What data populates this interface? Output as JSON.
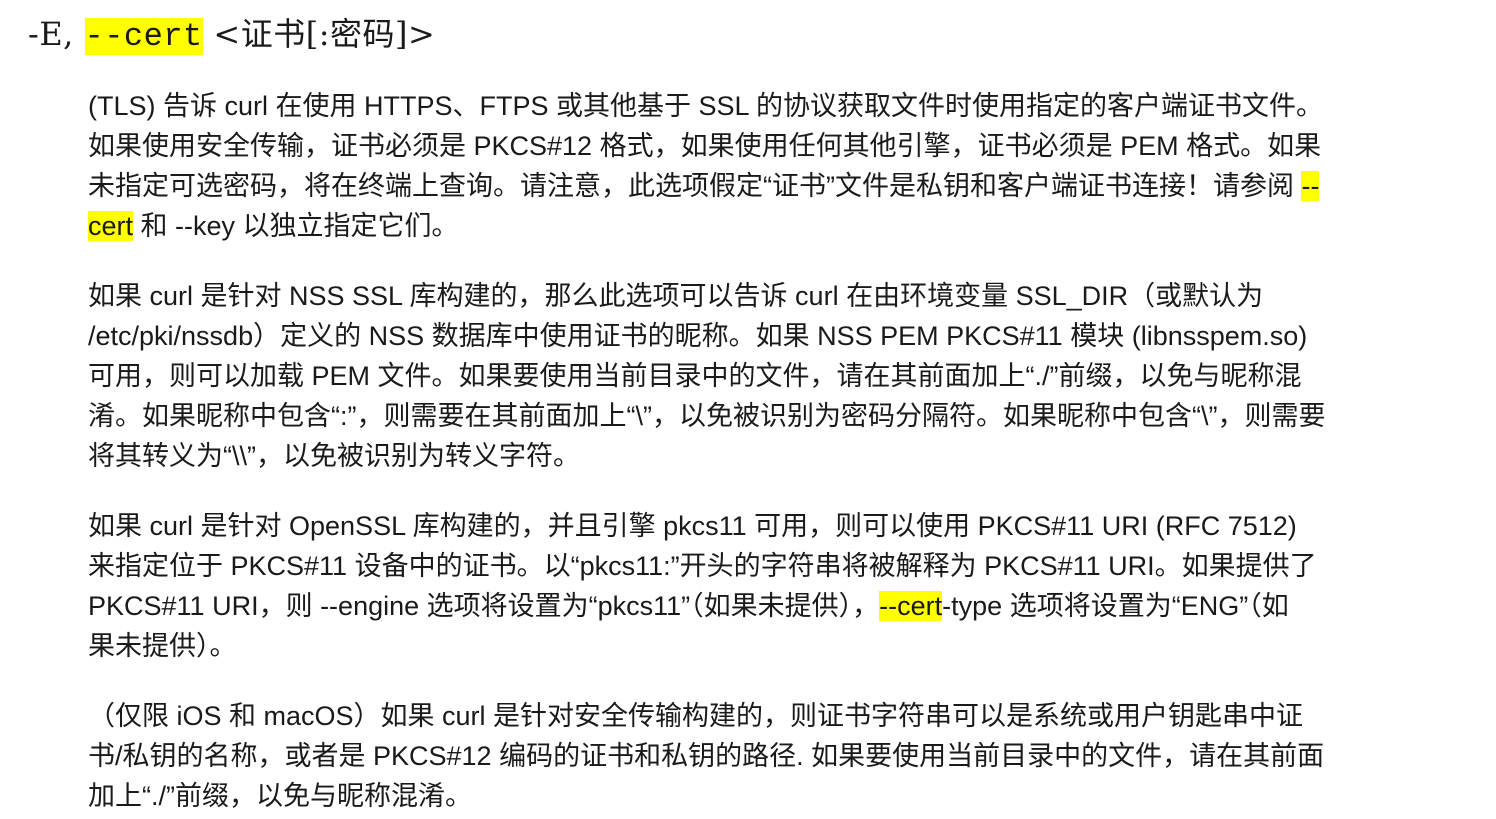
{
  "heading": {
    "prefix": "-E, ",
    "option": "--cert",
    "gap": " ",
    "argument": "<证书[:密码]>"
  },
  "paragraphs": [
    {
      "lines": [
        {
          "parts": [
            "(TLS) 告诉 curl 在使用 HTTPS、FTPS 或其他基于 SSL 的协议获取文件时使用指定的客户端证书文件。"
          ]
        },
        {
          "parts": [
            "如果使用安全传输，证书必须是 PKCS#12 格式，如果使用任何其他引擎，证书必须是 PEM 格式。如果"
          ]
        },
        {
          "parts": [
            "未指定可选密码，将在终端上查询。请注意，此选项假定“证书”文件是私钥和客户端证书连接！请参阅 "
          ],
          "highlight": "--"
        },
        {
          "highlight_lead": "cert",
          "parts": [
            " 和 --key 以独立指定它们。"
          ]
        }
      ]
    },
    {
      "lines": [
        {
          "parts": [
            "如果 curl 是针对 NSS SSL 库构建的，那么此选项可以告诉 curl 在由环境变量 SSL_DIR（或默认为"
          ]
        },
        {
          "parts": [
            "/etc/pki/nssdb）定义的 NSS 数据库中使用证书的昵称。如果 NSS PEM PKCS#11 模块 (libnsspem.so)"
          ]
        },
        {
          "parts": [
            "可用，则可以加载 PEM 文件。如果要使用当前目录中的文件，请在其前面加上“./”前缀，以免与昵称混"
          ]
        },
        {
          "parts": [
            "淆。如果昵称中包含“:”，则需要在其前面加上“\\”，以免被识别为密码分隔符。如果昵称中包含“\\”，则需要"
          ]
        },
        {
          "parts": [
            "将其转义为“\\\\”，以免被识别为转义字符。"
          ]
        }
      ]
    },
    {
      "lines": [
        {
          "parts": [
            "如果 curl 是针对 OpenSSL 库构建的，并且引擎 pkcs11 可用，则可以使用 PKCS#11 URI (RFC 7512)"
          ]
        },
        {
          "parts": [
            "来指定位于 PKCS#11 设备中的证书。以“pkcs11:”开头的字符串将被解释为 PKCS#11 URI。如果提供了"
          ]
        },
        {
          "parts": [
            "PKCS#11 URI，则 --engine 选项将设置为“pkcs11”（如果未提供），"
          ],
          "highlight_mid": "--cert",
          "tail": "-type 选项将设置为“ENG”（如"
        },
        {
          "parts": [
            "果未提供）。"
          ]
        }
      ]
    },
    {
      "lines": [
        {
          "parts": [
            "（仅限 iOS 和 macOS）如果 curl 是针对安全传输构建的，则证书字符串可以是系统或用户钥匙串中证"
          ]
        },
        {
          "parts": [
            "书/私钥的名称，或者是 PKCS#12 编码的证书和私钥的路径. 如果要使用当前目录中的文件，请在其前面"
          ]
        },
        {
          "parts": [
            "加上“./”前缀，以免与昵称混淆。"
          ]
        }
      ]
    }
  ],
  "colors": {
    "highlight": "#ffff00",
    "text": "#1a1a1a",
    "background": "#ffffff"
  }
}
